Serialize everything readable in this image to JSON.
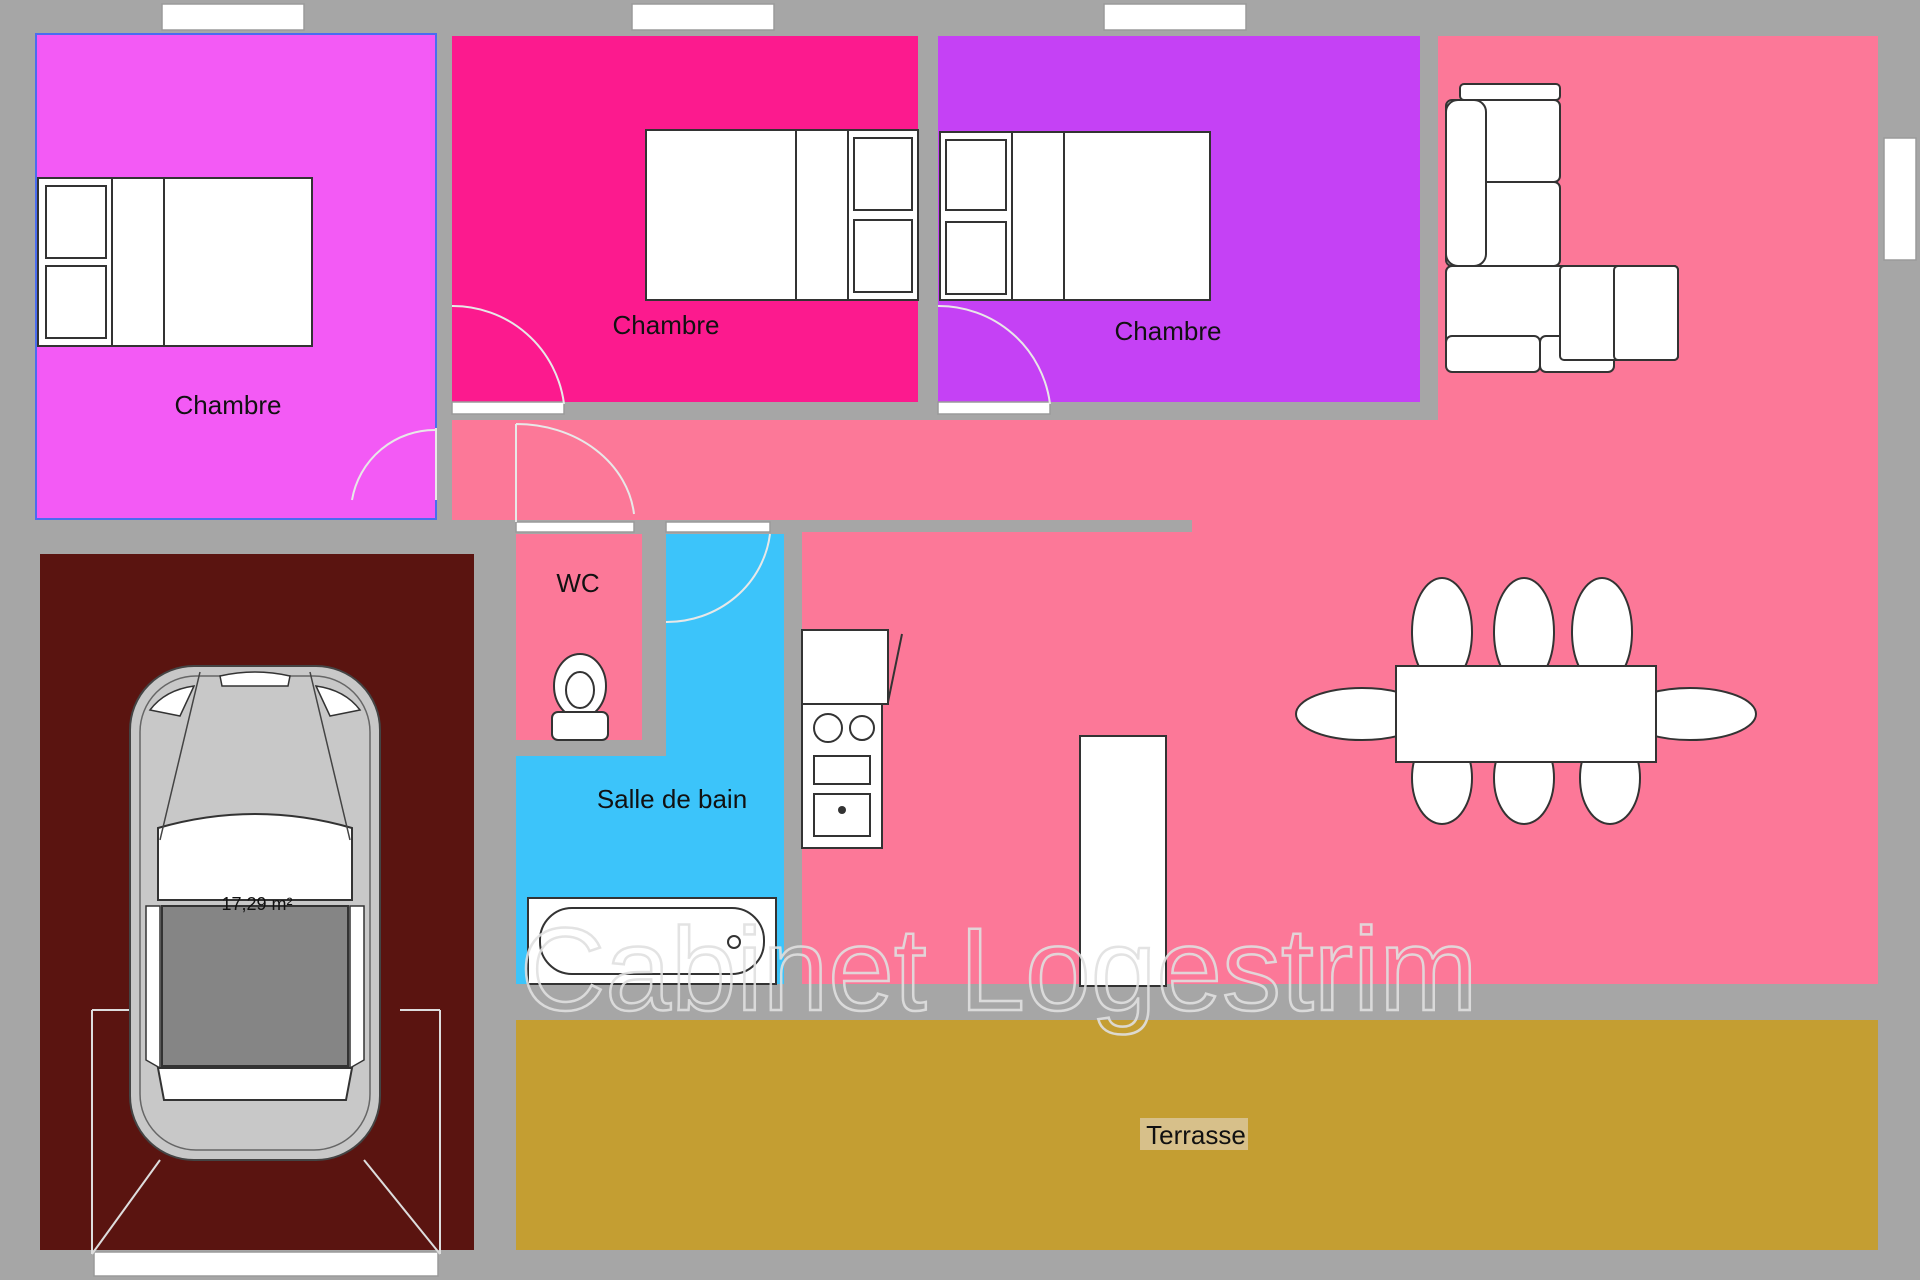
{
  "rooms": {
    "bedroom_1": {
      "label": "Chambre",
      "color": "#f35af5"
    },
    "bedroom_2": {
      "label": "Chambre",
      "color": "#fc1a8e"
    },
    "bedroom_3": {
      "label": "Chambre",
      "color": "#c541f5"
    },
    "living": {
      "color": "#fc7898"
    },
    "wc": {
      "label": "WC",
      "color": "#fc7898"
    },
    "bathroom": {
      "label": "Salle de bain",
      "color": "#3cc4fa"
    },
    "garage": {
      "area": "17,29 m²",
      "color": "#5a1410"
    },
    "terrace": {
      "label": "Terrasse",
      "color": "#c49e32"
    }
  },
  "walls": {
    "color": "#a6a6a6"
  },
  "watermark": "Cabinet Logestrim"
}
